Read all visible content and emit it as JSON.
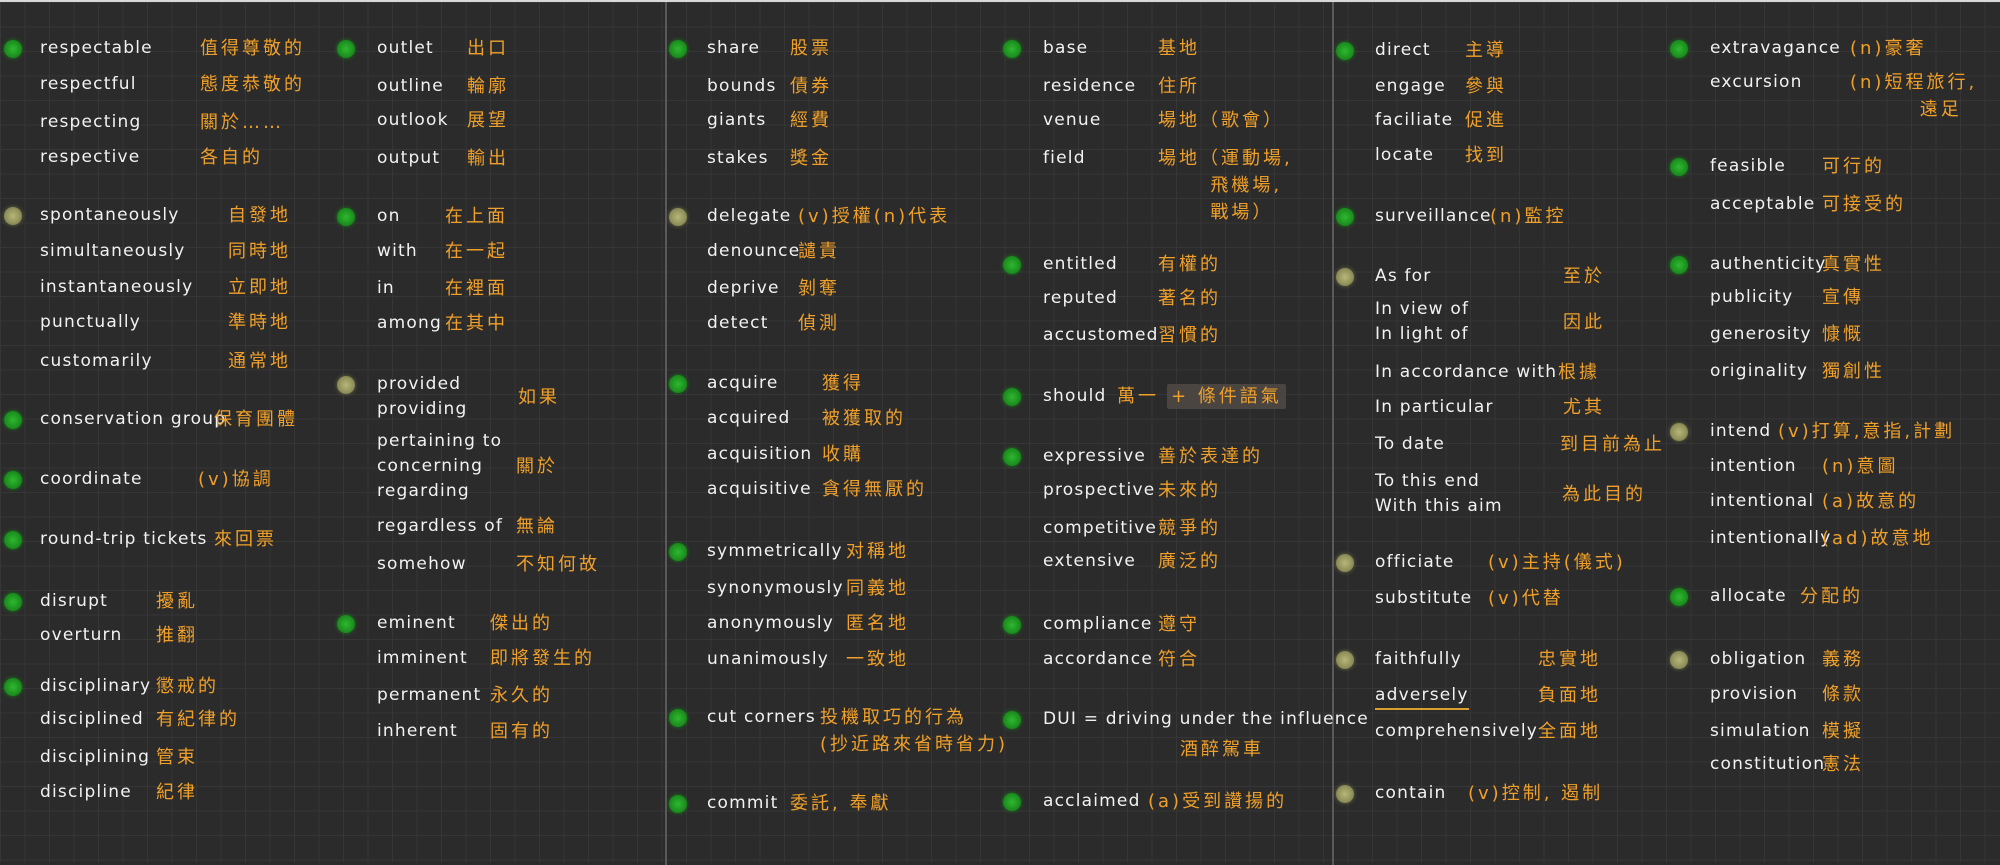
{
  "colors": {
    "green_dot": "#1c8f1f",
    "olive_dot": "#8f8f5a",
    "english": "#f2f2f2",
    "chinese": "#f0a02a",
    "background": "#2b2b2b"
  },
  "columns": [
    {
      "groups": [
        {
          "dot": "green",
          "items": [
            {
              "en": "respectable",
              "zh": "值得尊敬的"
            },
            {
              "en": "respectful",
              "zh": "態度恭敬的"
            },
            {
              "en": "respecting",
              "zh": "關於……"
            },
            {
              "en": "respective",
              "zh": "各自的"
            }
          ]
        },
        {
          "dot": "olive",
          "items": [
            {
              "en": "spontaneously",
              "zh": "自發地"
            },
            {
              "en": "simultaneously",
              "zh": "同時地"
            },
            {
              "en": "instantaneously",
              "zh": "立即地"
            },
            {
              "en": "punctually",
              "zh": "準時地"
            },
            {
              "en": "customarily",
              "zh": "通常地"
            }
          ]
        },
        {
          "dot": "green",
          "items": [
            {
              "en": "conservation group",
              "zh": "保育團體"
            }
          ]
        },
        {
          "dot": "green",
          "items": [
            {
              "en": "coordinate",
              "zh": "(v)協調"
            }
          ]
        },
        {
          "dot": "green",
          "items": [
            {
              "en": "round-trip tickets",
              "zh": "來回票"
            }
          ]
        },
        {
          "dot": "green",
          "items": [
            {
              "en": "disrupt",
              "zh": "擾亂"
            },
            {
              "en": "overturn",
              "zh": "推翻"
            }
          ]
        },
        {
          "dot": "green",
          "items": [
            {
              "en": "disciplinary",
              "zh": "懲戒的"
            },
            {
              "en": "disciplined",
              "zh": "有紀律的"
            },
            {
              "en": "disciplining",
              "zh": "管束"
            },
            {
              "en": "discipline",
              "zh": "紀律"
            }
          ]
        }
      ]
    },
    {
      "groups": [
        {
          "dot": "green",
          "items": [
            {
              "en": "outlet",
              "zh": "出口"
            },
            {
              "en": "outline",
              "zh": "輪廓"
            },
            {
              "en": "outlook",
              "zh": "展望"
            },
            {
              "en": "output",
              "zh": "輸出"
            }
          ]
        },
        {
          "dot": "green",
          "items": [
            {
              "en": "on",
              "zh": "在上面"
            },
            {
              "en": "with",
              "zh": "在一起"
            },
            {
              "en": "in",
              "zh": "在裡面"
            },
            {
              "en": "among",
              "zh": "在其中"
            }
          ]
        },
        {
          "dot": "olive",
          "items": [
            {
              "en": "provided\nproviding",
              "zh": "如果"
            },
            {
              "en": "pertaining to\nconcerning\nregarding",
              "zh": "關於"
            },
            {
              "en": "regardless of",
              "zh": "無論"
            },
            {
              "en": "somehow",
              "zh": "不知何故"
            }
          ]
        },
        {
          "dot": "green",
          "items": [
            {
              "en": "eminent",
              "zh": "傑出的"
            },
            {
              "en": "imminent",
              "zh": "即將發生的"
            },
            {
              "en": "permanent",
              "zh": "永久的"
            },
            {
              "en": "inherent",
              "zh": "固有的"
            }
          ]
        }
      ]
    },
    {
      "groups": [
        {
          "dot": "green",
          "items": [
            {
              "en": "share",
              "zh": "股票"
            },
            {
              "en": "bounds",
              "zh": "債券"
            },
            {
              "en": "giants",
              "zh": "經費"
            },
            {
              "en": "stakes",
              "zh": "獎金"
            }
          ]
        },
        {
          "dot": "olive",
          "items": [
            {
              "en": "delegate",
              "zh": "(v)授權(n)代表"
            },
            {
              "en": "denounce",
              "zh": "譴責"
            },
            {
              "en": "deprive",
              "zh": "剝奪"
            },
            {
              "en": "detect",
              "zh": "偵測"
            }
          ]
        },
        {
          "dot": "green",
          "items": [
            {
              "en": "acquire",
              "zh": "獲得"
            },
            {
              "en": "acquired",
              "zh": "被獲取的"
            },
            {
              "en": "acquisition",
              "zh": "收購"
            },
            {
              "en": "acquisitive",
              "zh": "貪得無厭的"
            }
          ]
        },
        {
          "dot": "green",
          "items": [
            {
              "en": "symmetrically",
              "zh": "对稱地"
            },
            {
              "en": "synonymously",
              "zh": "同義地"
            },
            {
              "en": "anonymously",
              "zh": "匿名地"
            },
            {
              "en": "unanimously",
              "zh": "一致地"
            }
          ]
        },
        {
          "dot": "green",
          "items": [
            {
              "en": "cut corners",
              "zh": "投機取巧的行為\n(抄近路來省時省力)"
            }
          ]
        },
        {
          "dot": "green",
          "items": [
            {
              "en": "commit",
              "zh": "委託, 奉獻"
            }
          ]
        }
      ]
    },
    {
      "groups": [
        {
          "dot": "green",
          "items": [
            {
              "en": "base",
              "zh": "基地"
            },
            {
              "en": "residence",
              "zh": "住所"
            },
            {
              "en": "venue",
              "zh": "場地（歌會）"
            },
            {
              "en": "field",
              "zh": "場地（運動場,\n      飛機場,\n      戰場）"
            }
          ]
        },
        {
          "dot": "green",
          "items": [
            {
              "en": "entitled",
              "zh": "有權的"
            },
            {
              "en": "reputed",
              "zh": "著名的"
            },
            {
              "en": "accustomed",
              "zh": "習慣的"
            }
          ]
        },
        {
          "dot": "green",
          "items": [
            {
              "en": "should",
              "zh": "萬一",
              "zh_note": "+ 條件語氣"
            }
          ]
        },
        {
          "dot": "green",
          "items": [
            {
              "en": "expressive",
              "zh": "善於表達的"
            },
            {
              "en": "prospective",
              "zh": "未來的"
            },
            {
              "en": "competitive",
              "zh": "競爭的"
            },
            {
              "en": "extensive",
              "zh": "廣泛的"
            }
          ]
        },
        {
          "dot": "green",
          "items": [
            {
              "en": "compliance",
              "zh": "遵守"
            },
            {
              "en": "accordance",
              "zh": "符合"
            }
          ]
        },
        {
          "dot": "green",
          "items": [
            {
              "en": "DUI = driving under the influence",
              "zh": "酒醉駕車"
            }
          ]
        },
        {
          "dot": "green",
          "items": [
            {
              "en": "acclaimed",
              "zh": "(a)受到讚揚的"
            }
          ]
        }
      ]
    },
    {
      "groups": [
        {
          "dot": "green",
          "items": [
            {
              "en": "direct",
              "zh": "主導"
            },
            {
              "en": "engage",
              "zh": "參與"
            },
            {
              "en": "faciliate",
              "zh": "促進"
            },
            {
              "en": "locate",
              "zh": "找到"
            }
          ]
        },
        {
          "dot": "green",
          "items": [
            {
              "en": "surveillance",
              "zh": "(n)監控"
            }
          ]
        },
        {
          "dot": "olive",
          "items": [
            {
              "en": "As for",
              "zh": "至於"
            },
            {
              "en": "In view of\nIn light of",
              "zh": "因此"
            },
            {
              "en": "In accordance with",
              "zh": "根據"
            },
            {
              "en": "In particular",
              "zh": "尤其"
            },
            {
              "en": "To date",
              "zh": "到目前為止"
            },
            {
              "en": "To this end\nWith this aim",
              "zh": "為此目的"
            }
          ]
        },
        {
          "dot": "olive",
          "items": [
            {
              "en": "officiate",
              "zh": "(v)主持(儀式)"
            },
            {
              "en": "substitute",
              "zh": "(v)代替"
            }
          ]
        },
        {
          "dot": "olive",
          "items": [
            {
              "en": "faithfully",
              "zh": "忠實地"
            },
            {
              "en": "adversely",
              "zh": "負面地",
              "underlined": true
            },
            {
              "en": "comprehensively",
              "zh": "全面地"
            }
          ]
        },
        {
          "dot": "olive",
          "items": [
            {
              "en": "contain",
              "zh": "(v)控制, 遏制"
            }
          ]
        }
      ]
    },
    {
      "groups": [
        {
          "dot": "green",
          "items": [
            {
              "en": "extravagance",
              "zh": "(n)豪奢"
            },
            {
              "en": "excursion",
              "zh": "(n)短程旅行,\n        遠足"
            }
          ]
        },
        {
          "dot": "green",
          "items": [
            {
              "en": "feasible",
              "zh": "可行的"
            },
            {
              "en": "acceptable",
              "zh": "可接受的"
            }
          ]
        },
        {
          "dot": "green",
          "items": [
            {
              "en": "authenticity",
              "zh": "真實性"
            },
            {
              "en": "publicity",
              "zh": "宣傳"
            },
            {
              "en": "generosity",
              "zh": "慷慨"
            },
            {
              "en": "originality",
              "zh": "獨創性"
            }
          ]
        },
        {
          "dot": "olive",
          "items": [
            {
              "en": "intend",
              "zh": "(v)打算,意指,計劃"
            },
            {
              "en": "intention",
              "zh": "(n)意圖"
            },
            {
              "en": "intentional",
              "zh": "(a)故意的"
            },
            {
              "en": "intentionally",
              "zh": "(ad)故意地"
            }
          ]
        },
        {
          "dot": "green",
          "items": [
            {
              "en": "allocate",
              "zh": "分配的"
            }
          ]
        },
        {
          "dot": "olive",
          "items": [
            {
              "en": "obligation",
              "zh": "義務"
            },
            {
              "en": "provision",
              "zh": "條款"
            },
            {
              "en": "simulation",
              "zh": "模擬"
            },
            {
              "en": "constitution",
              "zh": "憲法"
            }
          ]
        }
      ]
    }
  ]
}
